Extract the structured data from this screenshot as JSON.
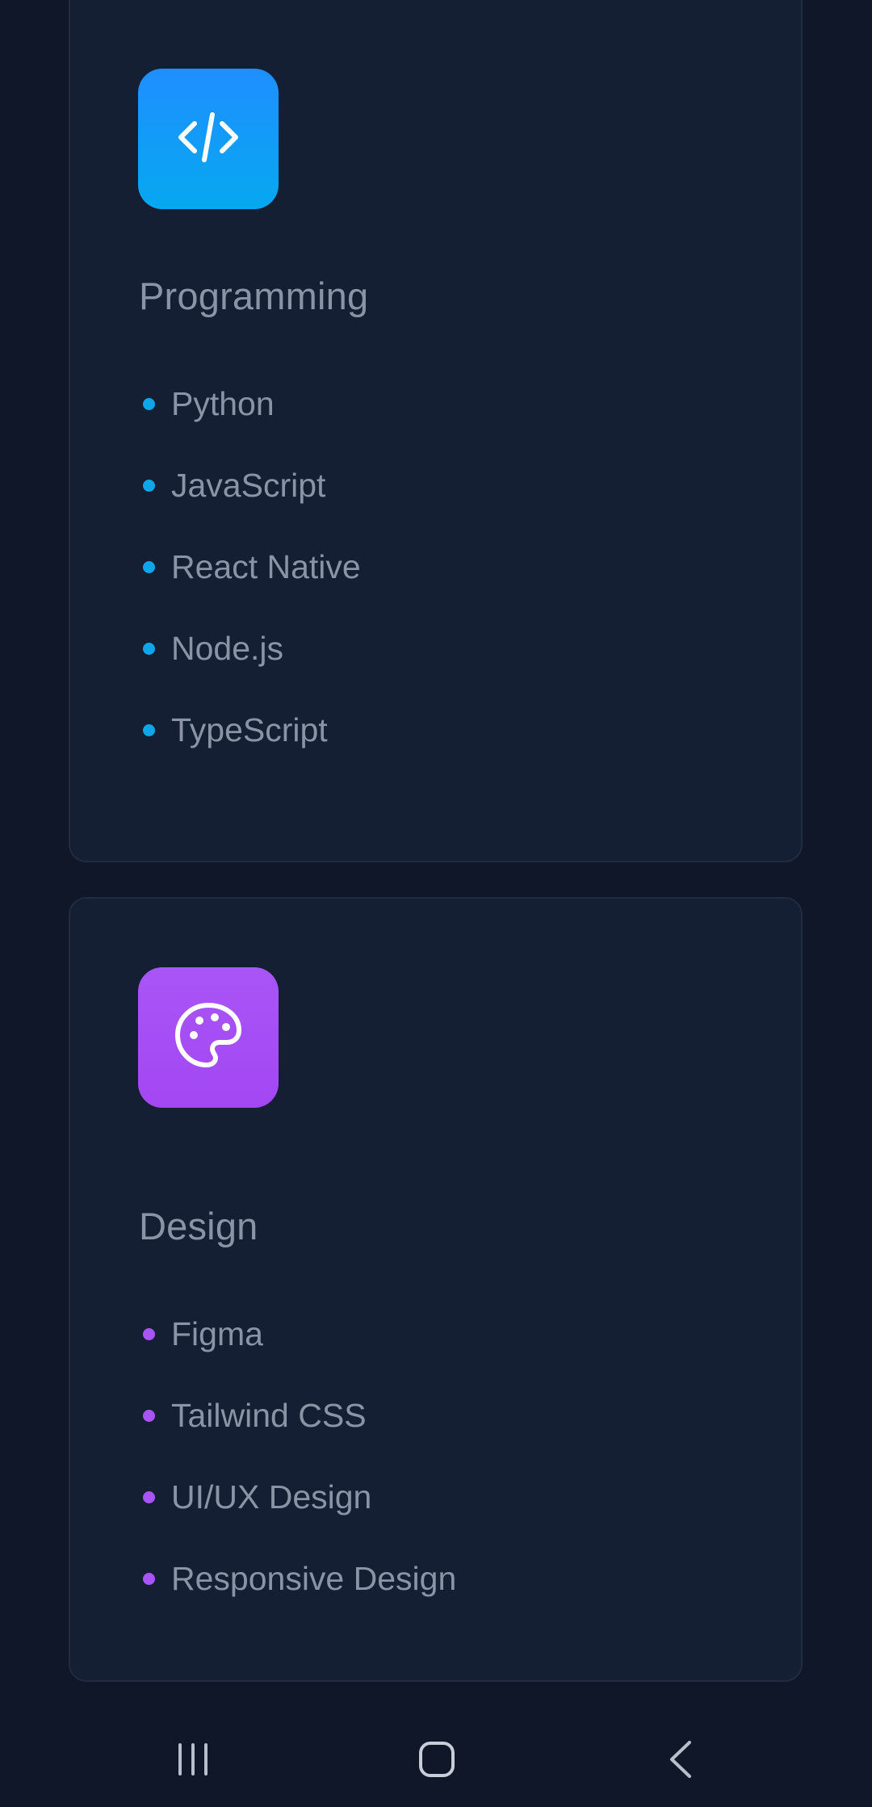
{
  "colors": {
    "background": "#0f1729",
    "card": "#151f33",
    "card_border": "#212c40",
    "text": "#8a94a6",
    "programming_accent": "#0ea5e9",
    "design_accent": "#a855f7"
  },
  "cards": [
    {
      "title": "Programming",
      "icon": "code-icon",
      "skills": [
        "Python",
        "JavaScript",
        "React Native",
        "Node.js",
        "TypeScript"
      ]
    },
    {
      "title": "Design",
      "icon": "palette-icon",
      "skills": [
        "Figma",
        "Tailwind CSS",
        "UI/UX Design",
        "Responsive Design"
      ]
    }
  ],
  "navigation": {
    "recents_icon": "recents-icon",
    "home_icon": "home-icon",
    "back_icon": "back-icon"
  }
}
